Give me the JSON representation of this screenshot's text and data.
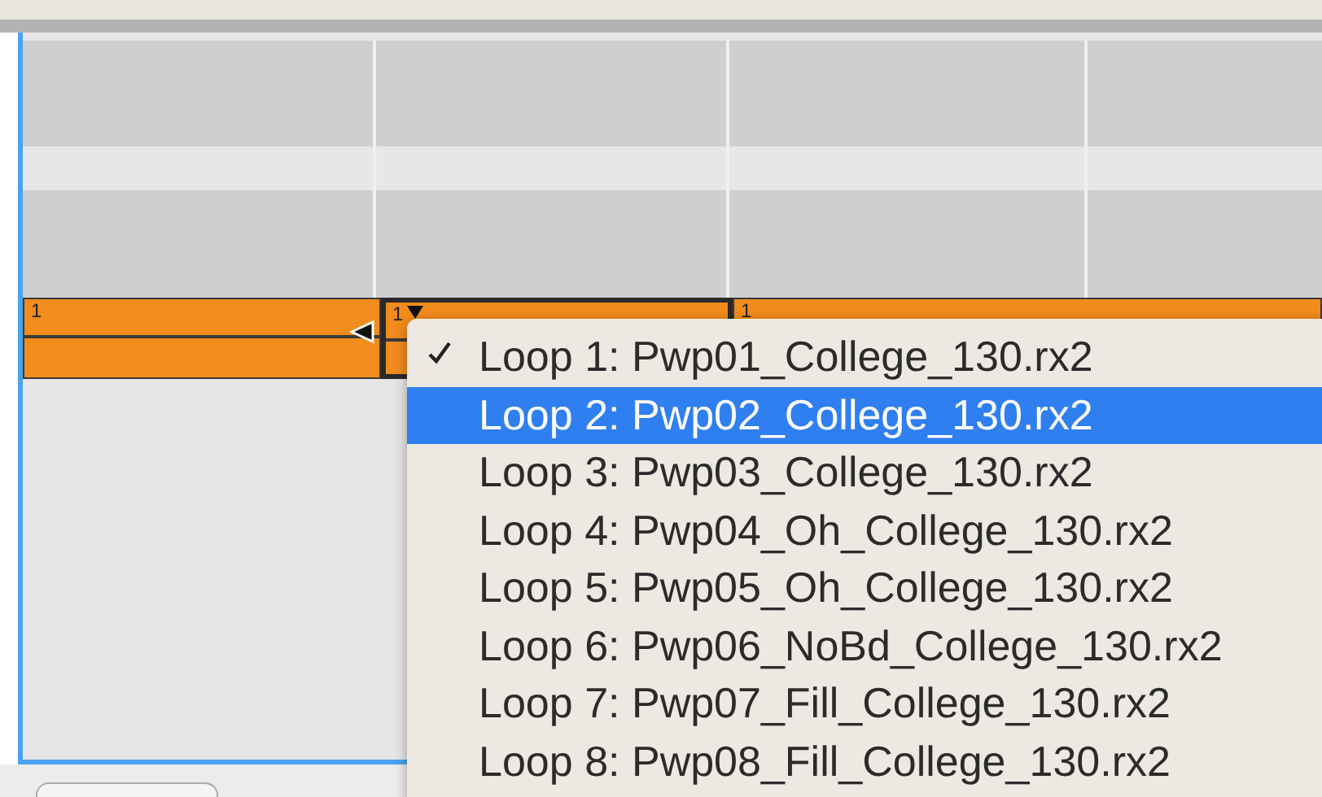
{
  "clips": [
    {
      "label": "1",
      "selected": false,
      "caret": false
    },
    {
      "label": "1",
      "selected": true,
      "caret": true
    },
    {
      "label": "1",
      "selected": false,
      "caret": false
    }
  ],
  "menu": {
    "items": [
      {
        "label": "Loop 1: Pwp01_College_130.rx2",
        "checked": true,
        "selected": false
      },
      {
        "label": "Loop 2: Pwp02_College_130.rx2",
        "checked": false,
        "selected": true
      },
      {
        "label": "Loop 3: Pwp03_College_130.rx2",
        "checked": false,
        "selected": false
      },
      {
        "label": "Loop 4: Pwp04_Oh_College_130.rx2",
        "checked": false,
        "selected": false
      },
      {
        "label": "Loop 5: Pwp05_Oh_College_130.rx2",
        "checked": false,
        "selected": false
      },
      {
        "label": "Loop 6: Pwp06_NoBd_College_130.rx2",
        "checked": false,
        "selected": false
      },
      {
        "label": "Loop 7: Pwp07_Fill_College_130.rx2",
        "checked": false,
        "selected": false
      },
      {
        "label": "Loop 8: Pwp08_Fill_College_130.rx2",
        "checked": false,
        "selected": false
      }
    ]
  }
}
